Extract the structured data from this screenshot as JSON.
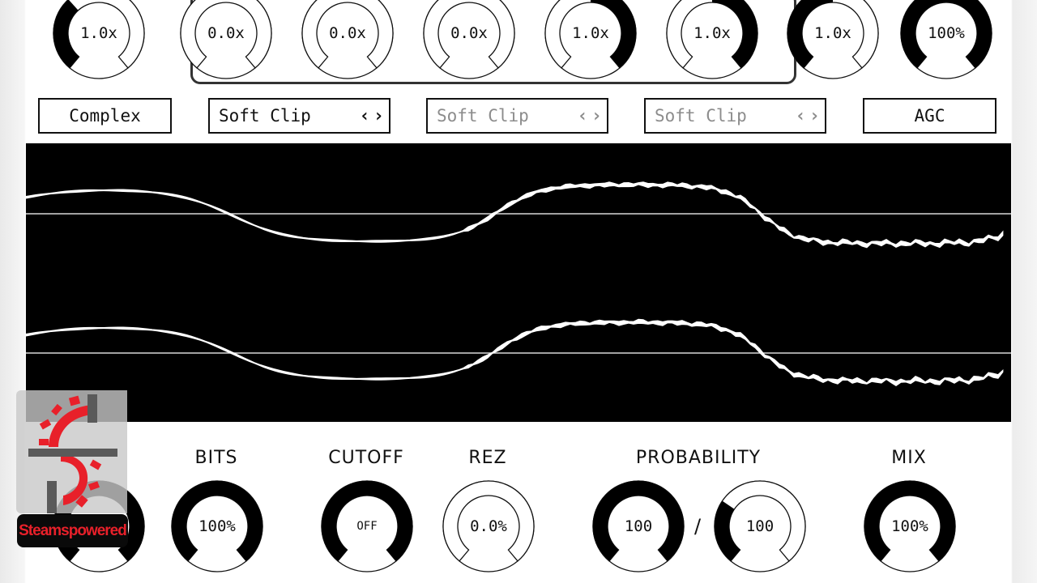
{
  "top_knobs": [
    {
      "id": "knob-top-1",
      "value_text": "1.0x",
      "fill_fraction": 0.35,
      "fill_from": "min"
    },
    {
      "id": "knob-top-2",
      "value_text": "0.0x",
      "fill_fraction": 0.0,
      "fill_from": "min"
    },
    {
      "id": "knob-top-3",
      "value_text": "0.0x",
      "fill_fraction": 0.0,
      "fill_from": "min"
    },
    {
      "id": "knob-top-4",
      "value_text": "0.0x",
      "fill_fraction": 0.0,
      "fill_from": "min"
    },
    {
      "id": "knob-top-5",
      "value_text": "1.0x",
      "fill_fraction": 0.5,
      "fill_from": "center-right"
    },
    {
      "id": "knob-top-6",
      "value_text": "1.0x",
      "fill_fraction": 0.5,
      "fill_from": "center-right"
    },
    {
      "id": "knob-top-7",
      "value_text": "1.0x",
      "fill_fraction": 0.5,
      "fill_from": "min"
    },
    {
      "id": "knob-top-8",
      "value_text": "100%",
      "fill_fraction": 1.0,
      "fill_from": "min"
    }
  ],
  "selectors": [
    {
      "label": "Complex",
      "has_arrows": false,
      "disabled": false
    },
    {
      "label": "Soft Clip",
      "has_arrows": true,
      "disabled": false
    },
    {
      "label": "Soft Clip",
      "has_arrows": true,
      "disabled": true
    },
    {
      "label": "Soft Clip",
      "has_arrows": true,
      "disabled": true
    },
    {
      "label": "AGC",
      "has_arrows": false,
      "disabled": false
    }
  ],
  "arrows": {
    "prev": "‹",
    "next": "›"
  },
  "scope": {
    "background": "#000000",
    "trace_color": "#ffffff",
    "channels": 2
  },
  "bottom_params": [
    {
      "label": "",
      "value_text": "",
      "fill_fraction": 1.0
    },
    {
      "label": "BITS",
      "value_text": "100%",
      "fill_fraction": 1.0
    },
    {
      "label": "CUTOFF",
      "value_text": "OFF",
      "fill_fraction": 1.0
    },
    {
      "label": "REZ",
      "value_text": "0.0%",
      "fill_fraction": 0.0
    },
    {
      "label": "PROBABILITY",
      "value_text": "100",
      "fill_fraction": 1.0
    },
    {
      "label": "",
      "value_text": "100",
      "fill_fraction": 0.3
    }
  ],
  "mix": {
    "label": "MIX",
    "value_text": "100%",
    "fill_fraction": 1.0
  },
  "probability_separator": "/",
  "watermark": {
    "text": "Steamspowered",
    "accent": "#e8202a"
  }
}
